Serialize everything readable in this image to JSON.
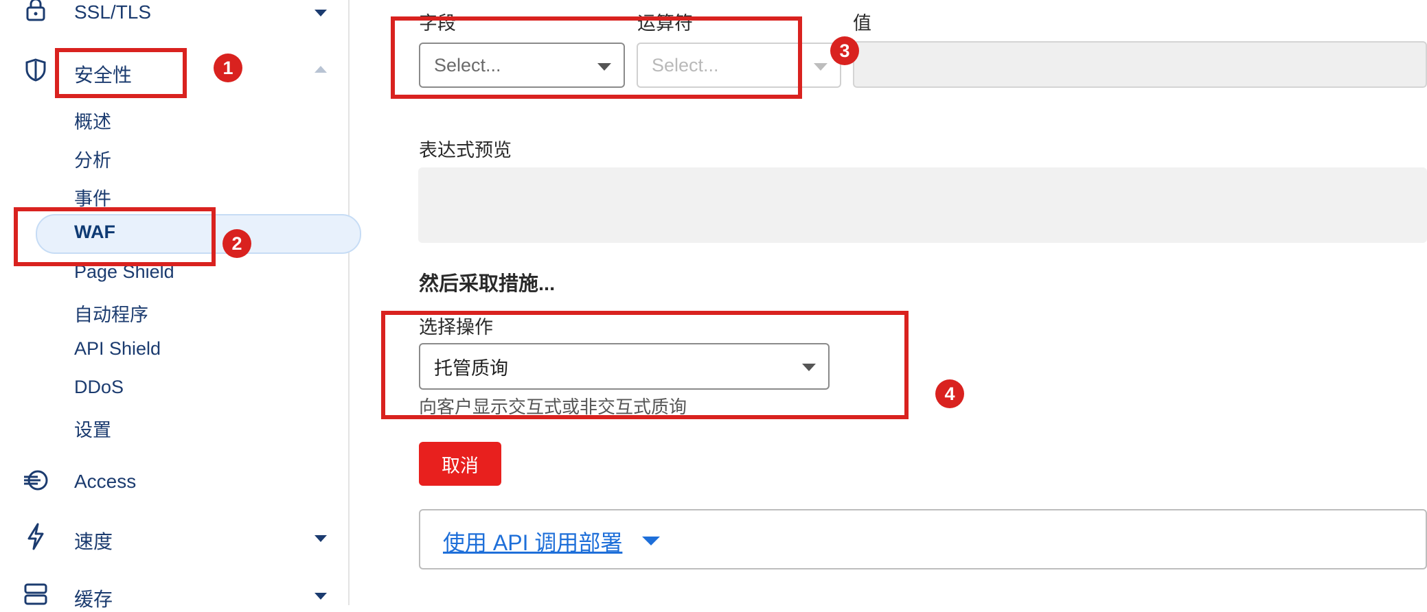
{
  "sidebar": {
    "ssl": {
      "label": "SSL/TLS",
      "icon": "lock-icon"
    },
    "security": {
      "label": "安全性",
      "icon": "shield-icon"
    },
    "security_items": [
      "概述",
      "分析",
      "事件",
      "WAF",
      "Page Shield",
      "自动程序",
      "API Shield",
      "DDoS",
      "设置"
    ],
    "access": {
      "label": "Access",
      "icon": "access-icon"
    },
    "speed": {
      "label": "速度",
      "icon": "lightning-icon"
    },
    "cache": {
      "label": "缓存",
      "icon": "server-stack-icon"
    }
  },
  "rule": {
    "field_label": "字段",
    "operator_label": "运算符",
    "value_label": "值",
    "field_placeholder": "Select...",
    "operator_placeholder": "Select...",
    "preview_label": "表达式预览"
  },
  "action": {
    "section_title": "然后采取措施...",
    "choose_label": "选择操作",
    "selected": "托管质询",
    "help": "向客户显示交互式或非交互式质询"
  },
  "buttons": {
    "cancel": "取消"
  },
  "api": {
    "link": "使用 API 调用部署"
  },
  "annotations": [
    "1",
    "2",
    "3",
    "4"
  ],
  "colors": {
    "annotation": "#d9221f",
    "brand_blue": "#1b3b6f",
    "link": "#1e6fd9",
    "danger": "#e8201e"
  }
}
